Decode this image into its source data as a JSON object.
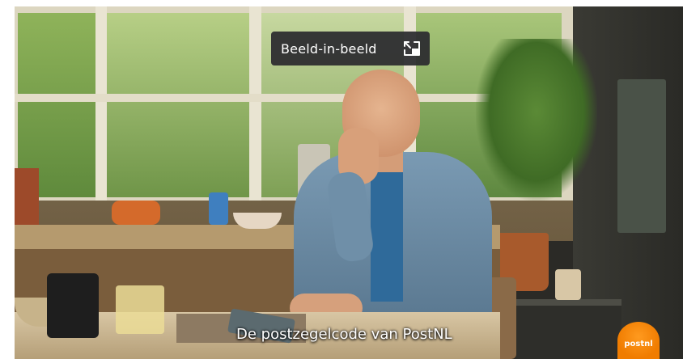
{
  "tooltip": {
    "label": "Beeld-in-beeld",
    "icon": "picture-in-picture-icon"
  },
  "video": {
    "subtitle": "De postzegelcode van PostNL"
  },
  "logo": {
    "text": "postnl",
    "color": "#F07C00"
  }
}
